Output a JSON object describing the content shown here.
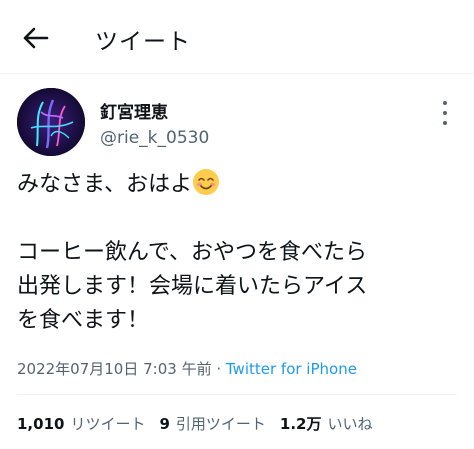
{
  "header": {
    "title": "ツイート",
    "back_icon": "arrow-left-icon"
  },
  "author": {
    "display_name": "釘宮理恵",
    "handle": "@rie_k_0530"
  },
  "tweet": {
    "line1": "みなさま、おはよ",
    "emoji": "smiling-face-emoji",
    "body": "コーヒー飲んで、おやつを食べたら\n出発します！会場に着いたらアイス\nを食べます！"
  },
  "meta": {
    "date": "2022年07月10日 7:03 午前 · ",
    "source": "Twitter for iPhone"
  },
  "stats": {
    "retweets_count": "1,010",
    "retweets_label": "リツイート",
    "quotes_count": "9",
    "quotes_label": "引用ツイート",
    "likes_count": "1.2万",
    "likes_label": "いいね"
  },
  "colors": {
    "link": "#1d9bf0",
    "secondary": "#536471",
    "text": "#0f1419"
  }
}
